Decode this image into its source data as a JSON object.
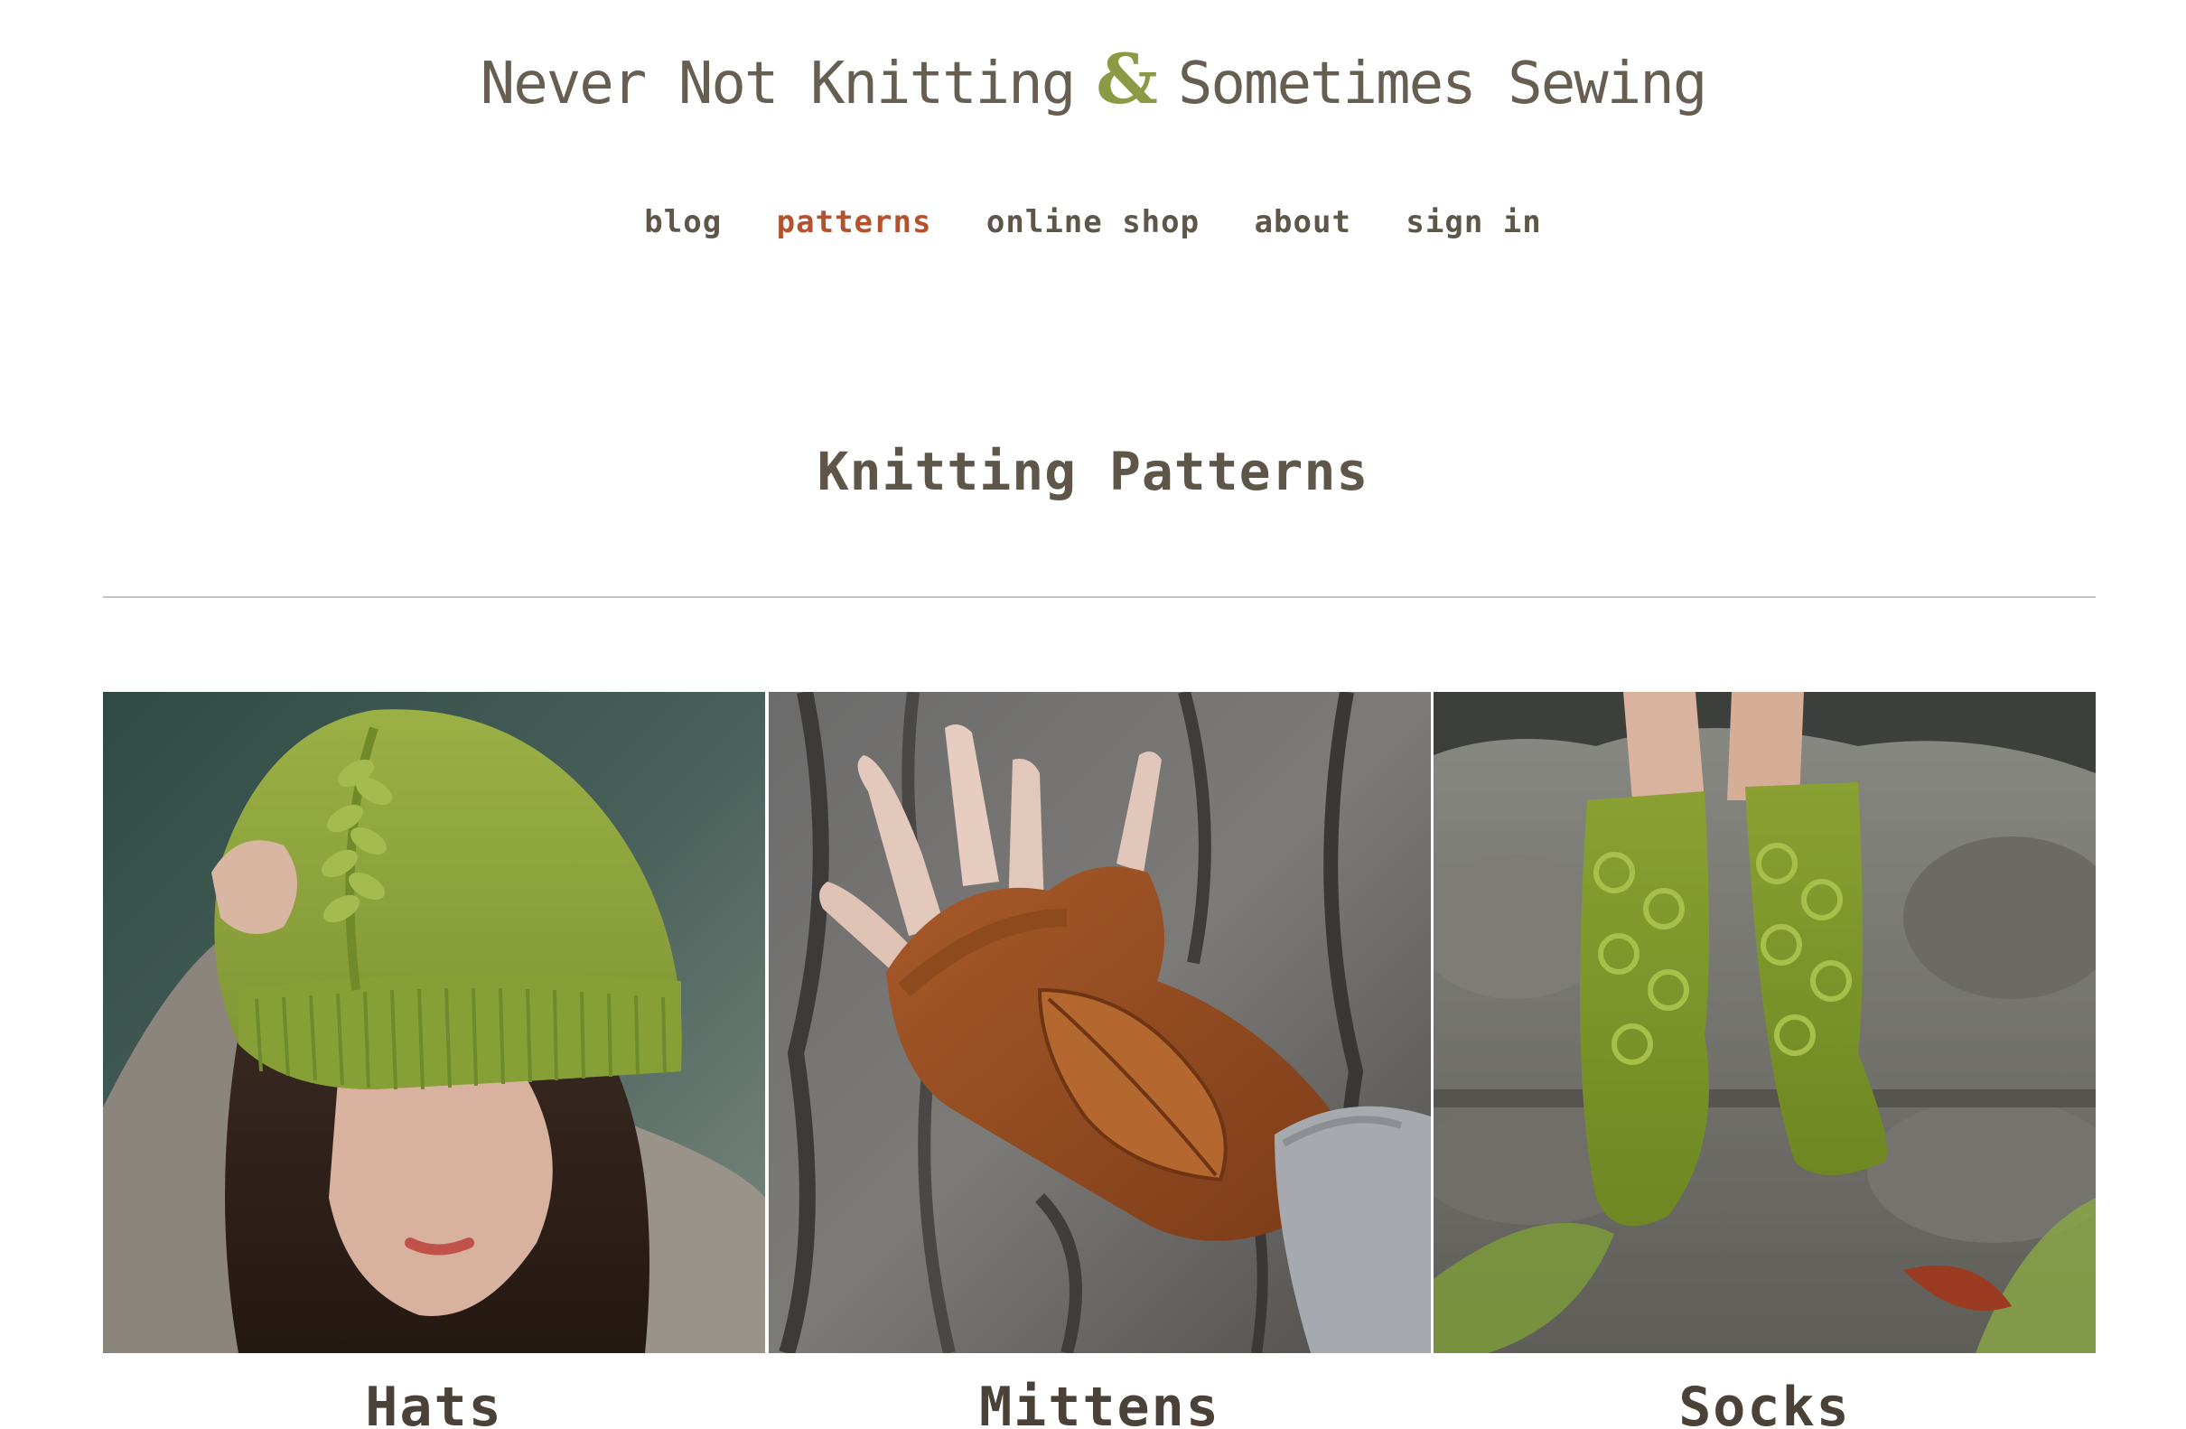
{
  "site": {
    "title_left": "Never Not Knitting",
    "title_amp": "&",
    "title_right": "Sometimes Sewing",
    "accent_color": "#8b9a45",
    "active_color": "#b5522d"
  },
  "nav": {
    "items": [
      {
        "label": "blog",
        "active": false
      },
      {
        "label": "patterns",
        "active": true
      },
      {
        "label": "online shop",
        "active": false
      },
      {
        "label": "about",
        "active": false
      },
      {
        "label": "sign in",
        "active": false
      }
    ]
  },
  "main": {
    "heading": "Knitting Patterns",
    "categories": [
      {
        "label": "Hats"
      },
      {
        "label": "Mittens"
      },
      {
        "label": "Socks"
      }
    ]
  }
}
